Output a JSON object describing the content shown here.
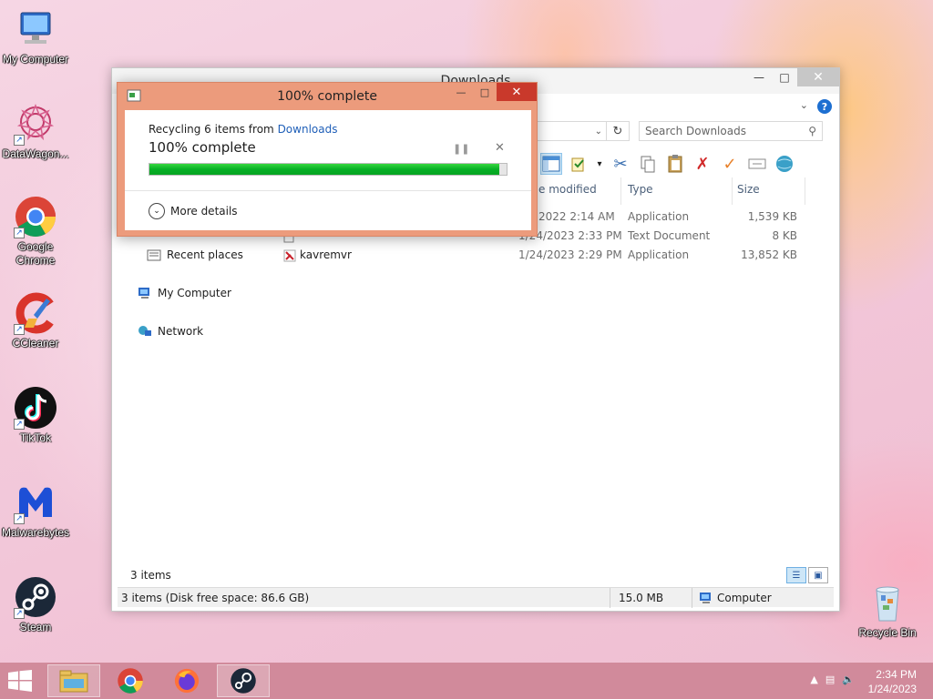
{
  "desktop": {
    "icons": [
      {
        "label": "My Computer"
      },
      {
        "label": "DataWagon..."
      },
      {
        "label": "Google Chrome"
      },
      {
        "label": "CCleaner"
      },
      {
        "label": "TikTok"
      },
      {
        "label": "Malwarebytes"
      },
      {
        "label": "Steam"
      }
    ],
    "recycle_bin": "Recycle Bin"
  },
  "explorer": {
    "title": "Downloads",
    "search_placeholder": "Search Downloads",
    "nav": {
      "recent": "Recent places",
      "computer": "My Computer",
      "network": "Network"
    },
    "columns": {
      "date": "e modified",
      "type": "Type",
      "size": "Size"
    },
    "files": [
      {
        "name": "",
        "date": "2022 2:14 AM",
        "type": "Application",
        "size": "1,539 KB"
      },
      {
        "name": "",
        "date": "1/24/2023 2:33 PM",
        "type": "Text Document",
        "size": "8 KB"
      },
      {
        "name": "kavremvr",
        "date": "1/24/2023 2:29 PM",
        "type": "Application",
        "size": "13,852 KB"
      }
    ],
    "item_count": "3 items",
    "status": {
      "left": "3 items (Disk free space: 86.6 GB)",
      "size": "15.0 MB",
      "location": "Computer"
    }
  },
  "dialog": {
    "title": "100% complete",
    "line_prefix": "Recycling 6 items from ",
    "line_link": "Downloads",
    "percent_text": "100% complete",
    "progress_fraction": 1.0,
    "more_details": "More details"
  },
  "taskbar": {
    "time": "2:34 PM",
    "date": "1/24/2023"
  },
  "colors": {
    "progress_green": "#06b025",
    "dialog_frame": "#ec9b7c",
    "close_red": "#c9392b",
    "link_blue": "#1f5fb8"
  }
}
